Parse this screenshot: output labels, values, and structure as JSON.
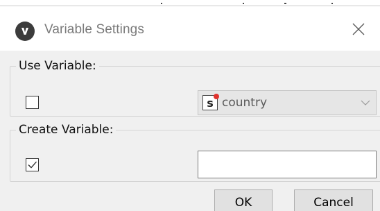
{
  "dialog": {
    "title": "Variable Settings",
    "app_icon": "v-logo-icon",
    "close_icon": "close-icon"
  },
  "use_variable": {
    "legend": "Use Variable:",
    "checked": false,
    "select": {
      "type_icon": "string-variable-icon",
      "type_icon_letter": "s",
      "value": "country",
      "disabled": true
    }
  },
  "create_variable": {
    "legend": "Create Variable:",
    "checked": true,
    "input_value": ""
  },
  "buttons": {
    "ok": "OK",
    "cancel": "Cancel"
  },
  "colors": {
    "dialog_bg": "#f0f0f0",
    "titlebar_bg": "#ffffff",
    "title_text": "#7a7a7a",
    "variable_dot": "#e0322d"
  }
}
